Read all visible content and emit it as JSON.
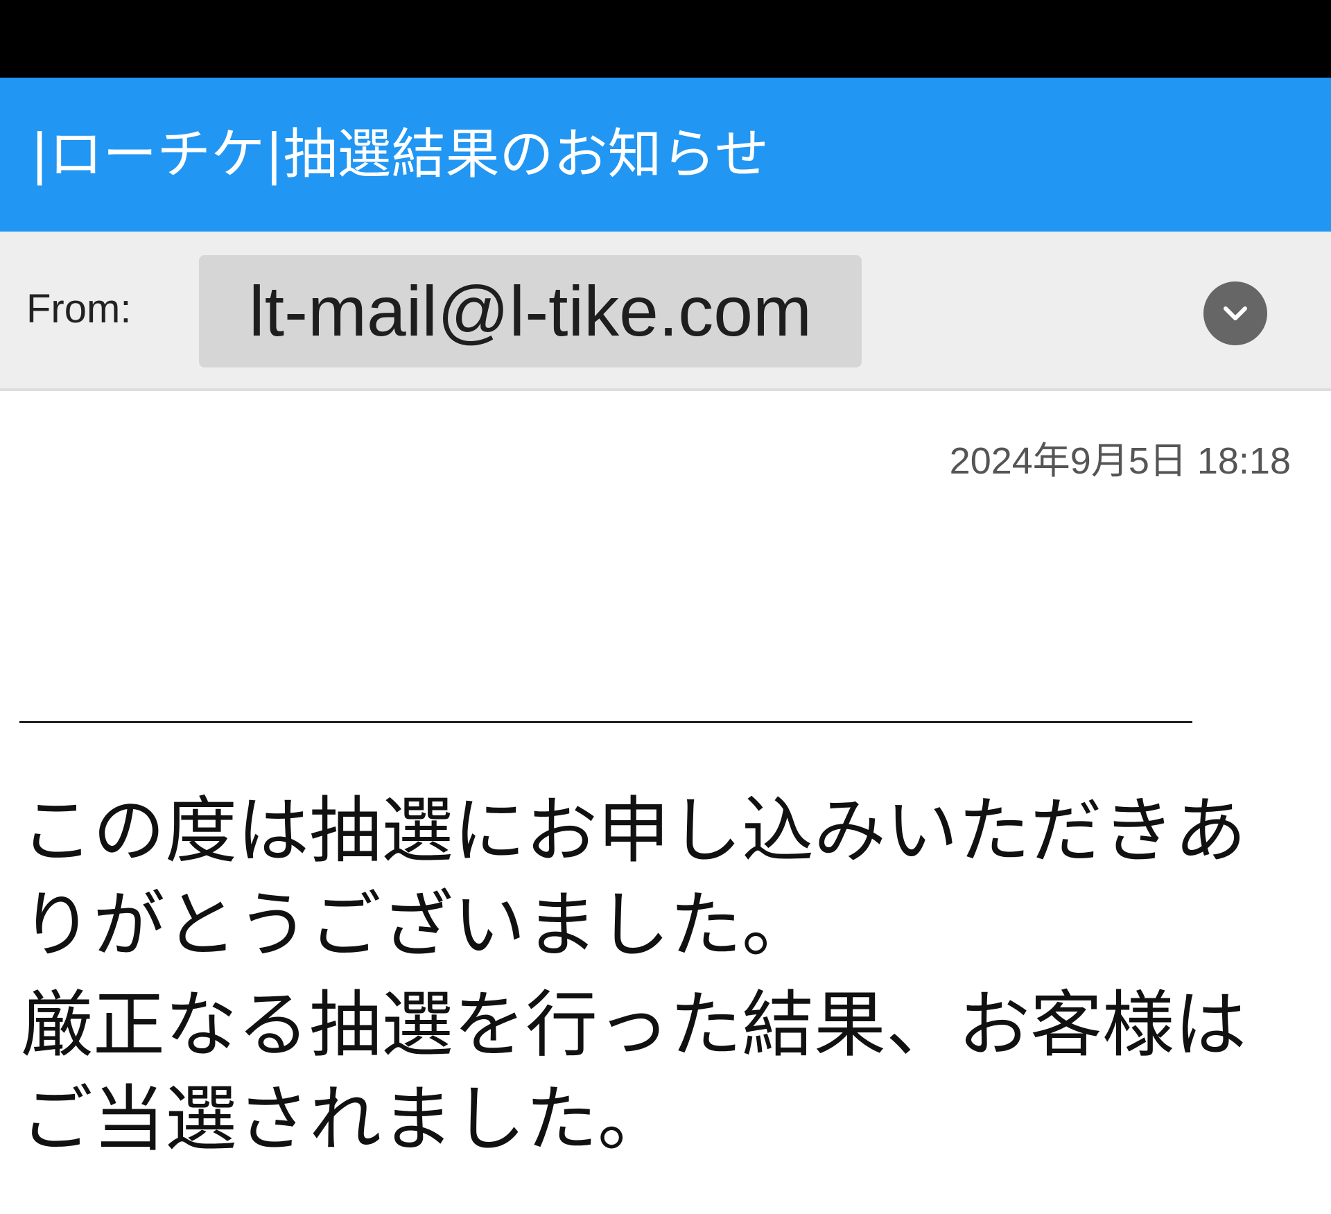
{
  "header": {
    "subject": "|ローチケ|抽選結果のお知らせ"
  },
  "sender": {
    "label": "From:",
    "address": "lt-mail@l-tike.com"
  },
  "message": {
    "date": "2024年9月5日 18:18",
    "paragraphs": [
      "この度は抽選にお申し込みいただきありがとうございました。",
      "厳正なる抽選を行った結果、お客様はご当選されました。"
    ]
  },
  "colors": {
    "accent": "#2196F3",
    "status_bar": "#000000",
    "from_bg": "#EEEEEE",
    "chip_bg": "#D6D6D6"
  },
  "icons": {
    "expand": "chevron-down-icon"
  }
}
